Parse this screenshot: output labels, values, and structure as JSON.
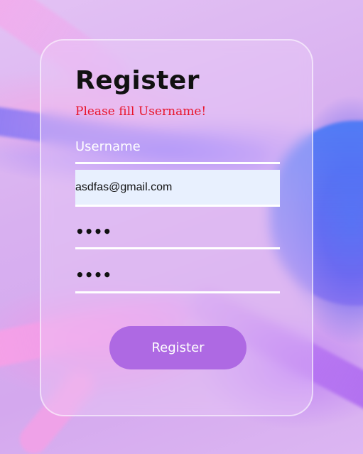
{
  "form": {
    "title": "Register",
    "error_message": "Please fill Username!",
    "username": {
      "placeholder": "Username",
      "value": ""
    },
    "email": {
      "value": "asdfas@gmail.com"
    },
    "password": {
      "value": "1234"
    },
    "confirm_password": {
      "value": "1234"
    },
    "submit_label": "Register"
  },
  "colors": {
    "error": "#e8142b",
    "button": "#ae69e3",
    "autofill_bg": "#e8f0fe"
  }
}
